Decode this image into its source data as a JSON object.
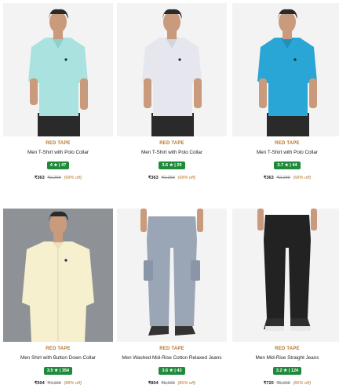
{
  "products": [
    {
      "brand": "RED TAPE",
      "title": "Men T-Shirt with Polo Collar",
      "rating": "4 ★ | 47",
      "price": "₹363",
      "mrp": "₹2,299",
      "off": "(68% off)",
      "image": "mint-polo-tshirt",
      "bg": "#f3f3f3",
      "garment": "#a9e2de",
      "pants": "#2a2a2a",
      "skin": "#c99a7c"
    },
    {
      "brand": "RED TAPE",
      "title": "Men T-Shirt with Polo Collar",
      "rating": "3.6 ★ | 20",
      "price": "₹363",
      "mrp": "₹2,299",
      "off": "(68% off)",
      "image": "white-polo-tshirt",
      "bg": "#f3f3f3",
      "garment": "#e6e6ee",
      "pants": "#2a2a2a",
      "skin": "#c99a7c"
    },
    {
      "brand": "RED TAPE",
      "title": "Men T-Shirt with Polo Collar",
      "rating": "3.7 ★ | 44",
      "price": "₹363",
      "mrp": "₹2,299",
      "off": "(68% off)",
      "image": "blue-polo-tshirt",
      "bg": "#f3f3f3",
      "garment": "#2aa6d6",
      "pants": "#2a2a2a",
      "skin": "#c99a7c"
    },
    {
      "brand": "RED TAPE",
      "title": "Men Shirt with Button Down Collar",
      "rating": "3.5 ★ | 354",
      "price": "₹504",
      "mrp": "₹4,199",
      "off": "(88% off)",
      "image": "cream-button-down-shirt",
      "bg": "#8e9296",
      "garment": "#f6f0cf",
      "pants": "#8e9296",
      "skin": "#c99a7c"
    },
    {
      "brand": "RED TAPE",
      "title": "Men Washed Mid-Rise Cotton Relaxed Jeans",
      "rating": "3.6 ★ | 43",
      "price": "₹804",
      "mrp": "₹5,699",
      "off": "(86% off)",
      "image": "washed-cargo-jeans",
      "bg": "#f3f3f3",
      "garment": "#9aa6b6",
      "pants": "#9aa6b6",
      "skin": "#c99a7c"
    },
    {
      "brand": "RED TAPE",
      "title": "Men Mid-Rise Straight Jeans",
      "rating": "3.2 ★ | 124",
      "price": "₹720",
      "mrp": "₹5,099",
      "off": "(86% off)",
      "image": "black-straight-jeans",
      "bg": "#f3f3f3",
      "garment": "#222222",
      "pants": "#222222",
      "skin": "#c99a7c"
    }
  ],
  "colors": {
    "brand": "#b8762a",
    "rating_bg": "#1f8a3a",
    "discount": "#b8762a"
  }
}
